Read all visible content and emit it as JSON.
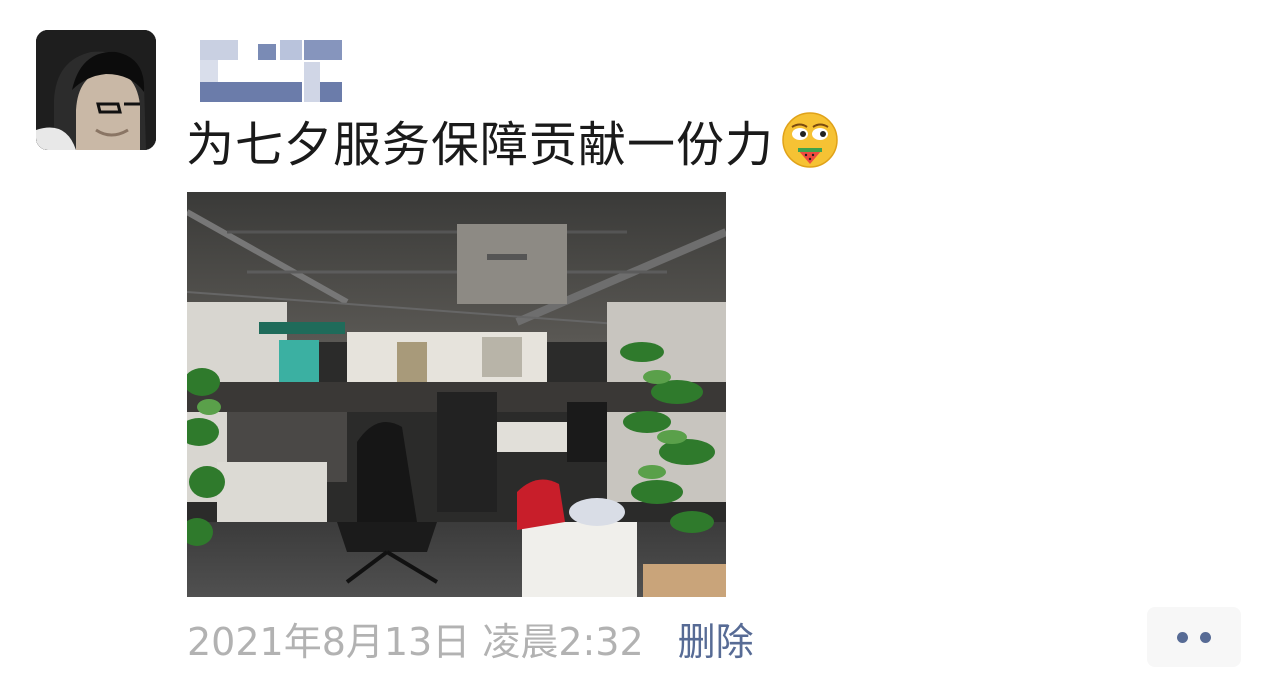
{
  "post": {
    "text": "为七夕服务保障贡献一份力",
    "emoji": "drooling-watermelon-emoji",
    "timestamp": "2021年8月13日 凌晨2:32",
    "delete_label": "删除",
    "more_icon": "more-dots-icon"
  },
  "colors": {
    "link": "#576b95",
    "timestamp": "#b2b2b2",
    "text": "#1a1a1a",
    "more_bg": "#f7f7f7"
  }
}
